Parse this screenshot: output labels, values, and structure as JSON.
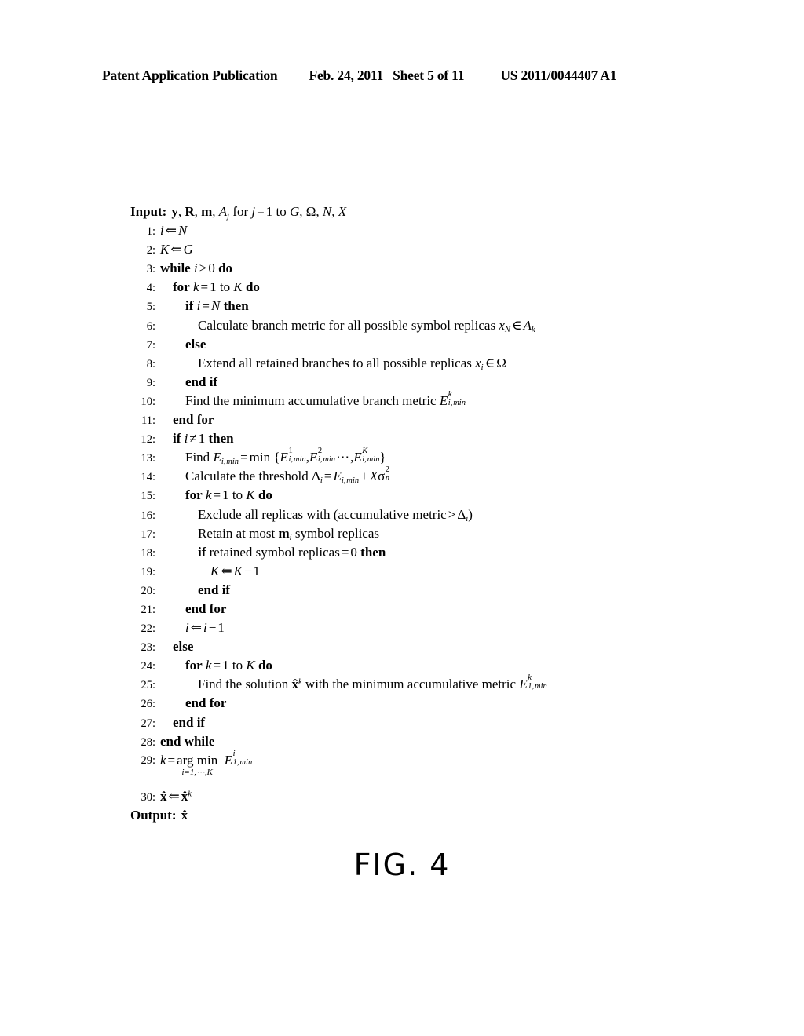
{
  "header": {
    "publication": "Patent Application Publication",
    "date": "Feb. 24, 2011",
    "sheet": "Sheet 5 of 11",
    "patent_number": "US 2011/0044407 A1"
  },
  "figure": {
    "caption": "FIG. 4"
  },
  "algorithm": {
    "input_label": "Input:",
    "input_text": "y, R, m, A_j for j = 1 to G, Ω, N, X",
    "output_label": "Output:",
    "output_text": "x̂",
    "lines": [
      {
        "n": "1:",
        "indent": 0,
        "text": "i ⇐ N"
      },
      {
        "n": "2:",
        "indent": 0,
        "text": "K ⇐ G"
      },
      {
        "n": "3:",
        "indent": 0,
        "text": "while i > 0 do"
      },
      {
        "n": "4:",
        "indent": 1,
        "text": "for k = 1 to K do"
      },
      {
        "n": "5:",
        "indent": 2,
        "text": "if i = N then"
      },
      {
        "n": "6:",
        "indent": 3,
        "text": "Calculate branch metric for all possible symbol replicas x_N ∈ A_k"
      },
      {
        "n": "7:",
        "indent": 2,
        "text": "else"
      },
      {
        "n": "8:",
        "indent": 3,
        "text": "Extend all retained branches to all possible replicas x_i ∈ Ω"
      },
      {
        "n": "9:",
        "indent": 2,
        "text": "end if"
      },
      {
        "n": "10:",
        "indent": 2,
        "text": "Find the minimum accumulative branch metric E^k_{i,min}"
      },
      {
        "n": "11:",
        "indent": 1,
        "text": "end for"
      },
      {
        "n": "12:",
        "indent": 1,
        "text": "if i ≠ 1 then"
      },
      {
        "n": "13:",
        "indent": 2,
        "text": "Find E_{i,min} = min {E^1_{i,min}, E^2_{i,min}, ⋯ , E^K_{i,min}}"
      },
      {
        "n": "14:",
        "indent": 2,
        "text": "Calculate the threshold Δ_i = E_{i,min} + X σ^2_n"
      },
      {
        "n": "15:",
        "indent": 2,
        "text": "for k = 1 to K do"
      },
      {
        "n": "16:",
        "indent": 3,
        "text": "Exclude all replicas with (accumulative metric > Δ_i)"
      },
      {
        "n": "17:",
        "indent": 3,
        "text": "Retain at most m_i symbol replicas"
      },
      {
        "n": "18:",
        "indent": 3,
        "text": "if retained symbol replicas = 0 then"
      },
      {
        "n": "19:",
        "indent": 4,
        "text": "K ⇐ K − 1"
      },
      {
        "n": "20:",
        "indent": 3,
        "text": "end if"
      },
      {
        "n": "21:",
        "indent": 2,
        "text": "end for"
      },
      {
        "n": "22:",
        "indent": 2,
        "text": "i ⇐ i − 1"
      },
      {
        "n": "23:",
        "indent": 1,
        "text": "else"
      },
      {
        "n": "24:",
        "indent": 2,
        "text": "for k = 1 to K do"
      },
      {
        "n": "25:",
        "indent": 3,
        "text": "Find the solution x̂^k with the minimum accumulative metric E^k_{1,min}"
      },
      {
        "n": "26:",
        "indent": 2,
        "text": "end for"
      },
      {
        "n": "27:",
        "indent": 1,
        "text": "end if"
      },
      {
        "n": "28:",
        "indent": 0,
        "text": "end while"
      },
      {
        "n": "29:",
        "indent": 0,
        "text": "k = arg min_{i=1,⋯,K} E^i_{1,min}"
      },
      {
        "n": "30:",
        "indent": 0,
        "text": "x̂ ⇐ x̂^k"
      }
    ],
    "tokens": {
      "input_label": "Input:",
      "output_label": "Output:",
      "kw_while": "while",
      "kw_do": "do",
      "kw_for": "for",
      "kw_if": "if",
      "kw_then": "then",
      "kw_else": "else",
      "kw_end_if": "end if",
      "kw_end_for": "end for",
      "kw_end_while": "end while",
      "t_calculate_branch": "Calculate branch metric for all possible symbol replicas",
      "t_extend": "Extend all retained branches to all possible replicas",
      "t_find_min_branch": "Find the minimum accumulative branch metric",
      "t_find": "Find",
      "t_min": "min",
      "t_calc_threshold": "Calculate the threshold",
      "t_exclude": "Exclude all replicas with (accumulative metric",
      "t_retain_a": "Retain at most",
      "t_retain_b": "symbol replicas",
      "t_if_retained": "retained symbol replicas",
      "t_find_solution": "Find the solution",
      "t_with_min_metric": "with the minimum accumulative metric",
      "t_argmin": "arg min",
      "t_argmin_sub": "i=1,⋯,K",
      "sym_min_sub": "min",
      "sym_i": "i",
      "sym_j": "j",
      "sym_k": "k",
      "sym_K": "K",
      "sym_N": "N",
      "sym_G": "G",
      "sym_X": "X",
      "sym_E": "E",
      "sym_A": "A",
      "sym_x": "x",
      "sym_xhat": "x̂",
      "sym_omega": "Ω",
      "sym_delta": "Δ",
      "sym_sigma": "σ",
      "sym_n": "n",
      "sym_m_bold": "m",
      "sym_y_bold": "y",
      "sym_R_bold": "R",
      "arrow_left": "⇐",
      "op_eq": "=",
      "op_neq": "≠",
      "op_gt": ">",
      "op_lt": "<",
      "op_plus": "+",
      "op_minus": "−",
      "op_in": "∈",
      "op_comma": ",",
      "op_dots": "⋯",
      "brace_l": "{",
      "brace_r": "}",
      "paren_r": ")",
      "num_0": "0",
      "num_1": "1",
      "num_2": "2",
      "for_word": "for",
      "to_word": "to",
      "one": "1"
    }
  },
  "colors": {
    "page_background": "#ffffff",
    "text": "#000000"
  }
}
